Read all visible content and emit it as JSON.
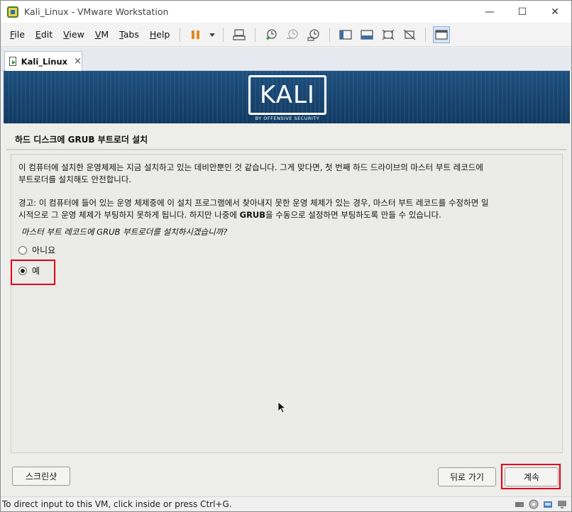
{
  "window": {
    "title": "Kali_Linux - VMware Workstation",
    "minimize": "—",
    "maximize": "☐",
    "close": "✕"
  },
  "menu": {
    "items": [
      {
        "ul": "F",
        "rest": "ile"
      },
      {
        "ul": "E",
        "rest": "dit"
      },
      {
        "ul": "V",
        "rest": "iew"
      },
      {
        "ul": "V",
        "rest": "M"
      },
      {
        "ul": "T",
        "rest": "abs"
      },
      {
        "ul": "H",
        "rest": "elp"
      }
    ]
  },
  "tab": {
    "label": "Kali_Linux",
    "close": "×"
  },
  "banner": {
    "logo": "KALI",
    "sub": "BY OFFENSIVE SECURITY"
  },
  "installer": {
    "title": "하드 디스크에 GRUB 부트로더 설치",
    "para1_a": "이 컴퓨터에 설치한 운영체제는 지금 설치하고 있는 데비안뿐인 것 같습니다. 그게 맞다면, 첫 번째 하드 드라이브의 마스터 부트 레코드에",
    "para1_b": "부트로더를 설치해도 안전합니다.",
    "para2_a": "경고: 이 컴퓨터에 들어 있는 운영 체제중에 이 설치 프로그램에서 찾아내지 못한 운영 체제가 있는 경우, 마스터 부트 레코드를 수정하면 일",
    "para2_b_pre": "시적으로 그 운영 체제가 부팅하지 못하게 됩니다. 하지만 나중에 ",
    "para2_b_bold": "GRUB",
    "para2_b_post": "을 수동으로 설정하면 부팅하도록 만들 수 있습니다.",
    "question": "마스터 부트 레코드에 GRUB 부트로더를 설치하시겠습니까?",
    "option_no": "아니요",
    "option_yes": "예",
    "selected": "예",
    "screenshot_button": "스크린샷",
    "back_button": "뒤로 가기",
    "continue_button": "계속"
  },
  "statusbar": {
    "text": "To direct input to this VM, click inside or press Ctrl+G."
  },
  "colors": {
    "banner": "#1a4a78",
    "highlight": "#e0001a"
  }
}
